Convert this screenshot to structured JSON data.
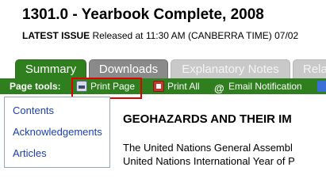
{
  "header": {
    "title": "1301.0 - Yearbook Complete, 2008",
    "issue_label": "LATEST ISSUE",
    "issue_text": "Released at 11:30 AM (CANBERRA TIME) 07/02"
  },
  "tabs": [
    {
      "label": "Summary",
      "state": "active"
    },
    {
      "label": "Downloads",
      "state": "normal"
    },
    {
      "label": "Explanatory Notes",
      "state": "disabled"
    },
    {
      "label": "Rela",
      "state": "disabled"
    }
  ],
  "toolbar": {
    "label": "Page tools:",
    "items": [
      {
        "label": "Print Page",
        "icon": "printer-icon"
      },
      {
        "label": "Print All",
        "icon": "print-all-icon"
      },
      {
        "label": "Email Notification",
        "icon": "at-sign-icon",
        "glyph": "@"
      },
      {
        "label": "",
        "icon": "rss-icon"
      }
    ]
  },
  "sidebar": {
    "links": [
      "Contents",
      "Acknowledgements",
      "Articles"
    ]
  },
  "content": {
    "heading": "GEOHAZARDS AND THEIR IM",
    "lines": [
      "The United Nations General Assembl",
      "United Nations International Year of P"
    ]
  },
  "colors": {
    "accent_green": "#2f7f1f",
    "highlight_red": "#e00000",
    "link_blue": "#1a3fb0"
  }
}
